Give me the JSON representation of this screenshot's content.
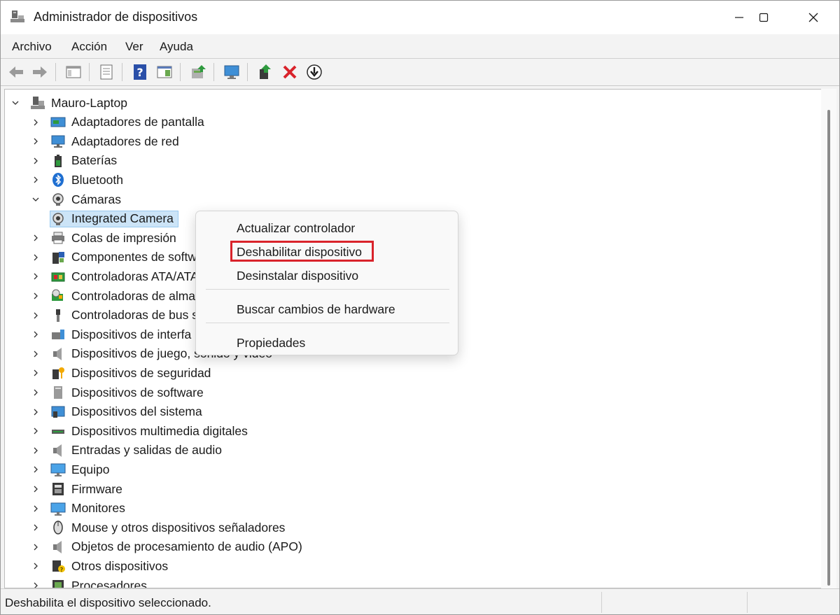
{
  "window": {
    "title": "Administrador de dispositivos",
    "icon": "device-manager-icon"
  },
  "menubar": {
    "items": [
      "Archivo",
      "Acción",
      "Ver",
      "Ayuda"
    ]
  },
  "toolbar": {
    "buttons": [
      "back-arrow-icon",
      "forward-arrow-icon",
      "show-hide-tree-icon",
      "properties-sheet-icon",
      "help-icon",
      "view-pane-icon",
      "update-driver-icon",
      "scan-monitor-icon",
      "enable-device-icon",
      "uninstall-x-icon",
      "download-driver-icon"
    ]
  },
  "tree": {
    "root": "Mauro-Laptop",
    "items": [
      {
        "label": "Adaptadores de pantalla",
        "icon": "display-adapter-icon",
        "expanded": false
      },
      {
        "label": "Adaptadores de red",
        "icon": "network-adapter-icon",
        "expanded": false
      },
      {
        "label": "Baterías",
        "icon": "battery-icon",
        "expanded": false
      },
      {
        "label": "Bluetooth",
        "icon": "bluetooth-icon",
        "expanded": false
      },
      {
        "label": "Cámaras",
        "icon": "camera-icon",
        "expanded": true
      },
      {
        "label": "Integrated Camera",
        "icon": "camera-icon",
        "child": true,
        "selected": true
      },
      {
        "label": "Colas de impresión",
        "icon": "printer-icon",
        "expanded": false
      },
      {
        "label": "Componentes de softw",
        "icon": "software-component-icon",
        "expanded": false
      },
      {
        "label": "Controladoras ATA/ATA",
        "icon": "ata-controller-icon",
        "expanded": false
      },
      {
        "label": "Controladoras de alma",
        "icon": "storage-controller-icon",
        "expanded": false
      },
      {
        "label": "Controladoras de bus s",
        "icon": "usb-icon",
        "expanded": false
      },
      {
        "label": "Dispositivos de interfa",
        "icon": "hid-icon",
        "expanded": false
      },
      {
        "label": "Dispositivos de juego, sonido y video",
        "icon": "speaker-icon",
        "expanded": false
      },
      {
        "label": "Dispositivos de seguridad",
        "icon": "security-key-icon",
        "expanded": false
      },
      {
        "label": "Dispositivos de software",
        "icon": "software-device-icon",
        "expanded": false
      },
      {
        "label": "Dispositivos del sistema",
        "icon": "system-device-icon",
        "expanded": false
      },
      {
        "label": "Dispositivos multimedia digitales",
        "icon": "multimedia-icon",
        "expanded": false
      },
      {
        "label": "Entradas y salidas de audio",
        "icon": "speaker-icon",
        "expanded": false
      },
      {
        "label": "Equipo",
        "icon": "monitor-icon",
        "expanded": false
      },
      {
        "label": "Firmware",
        "icon": "firmware-icon",
        "expanded": false
      },
      {
        "label": "Monitores",
        "icon": "monitor-icon",
        "expanded": false
      },
      {
        "label": "Mouse y otros dispositivos señaladores",
        "icon": "mouse-icon",
        "expanded": false
      },
      {
        "label": "Objetos de procesamiento de audio (APO)",
        "icon": "speaker-icon",
        "expanded": false
      },
      {
        "label": "Otros dispositivos",
        "icon": "unknown-device-icon",
        "expanded": false
      },
      {
        "label": "Procesadores",
        "icon": "processor-icon",
        "expanded": false
      }
    ]
  },
  "context_menu": {
    "items": [
      "Actualizar controlador",
      "Deshabilitar dispositivo",
      "Desinstalar dispositivo",
      "Buscar cambios de hardware",
      "Propiedades"
    ],
    "highlighted": "Deshabilitar dispositivo",
    "highlight_color": "#d9232b"
  },
  "statusbar": {
    "text": "Deshabilita el dispositivo seleccionado."
  },
  "colors": {
    "selection": "#cce4f7",
    "selection_border": "#99c9ef",
    "window_bg": "#f3f3f3"
  }
}
